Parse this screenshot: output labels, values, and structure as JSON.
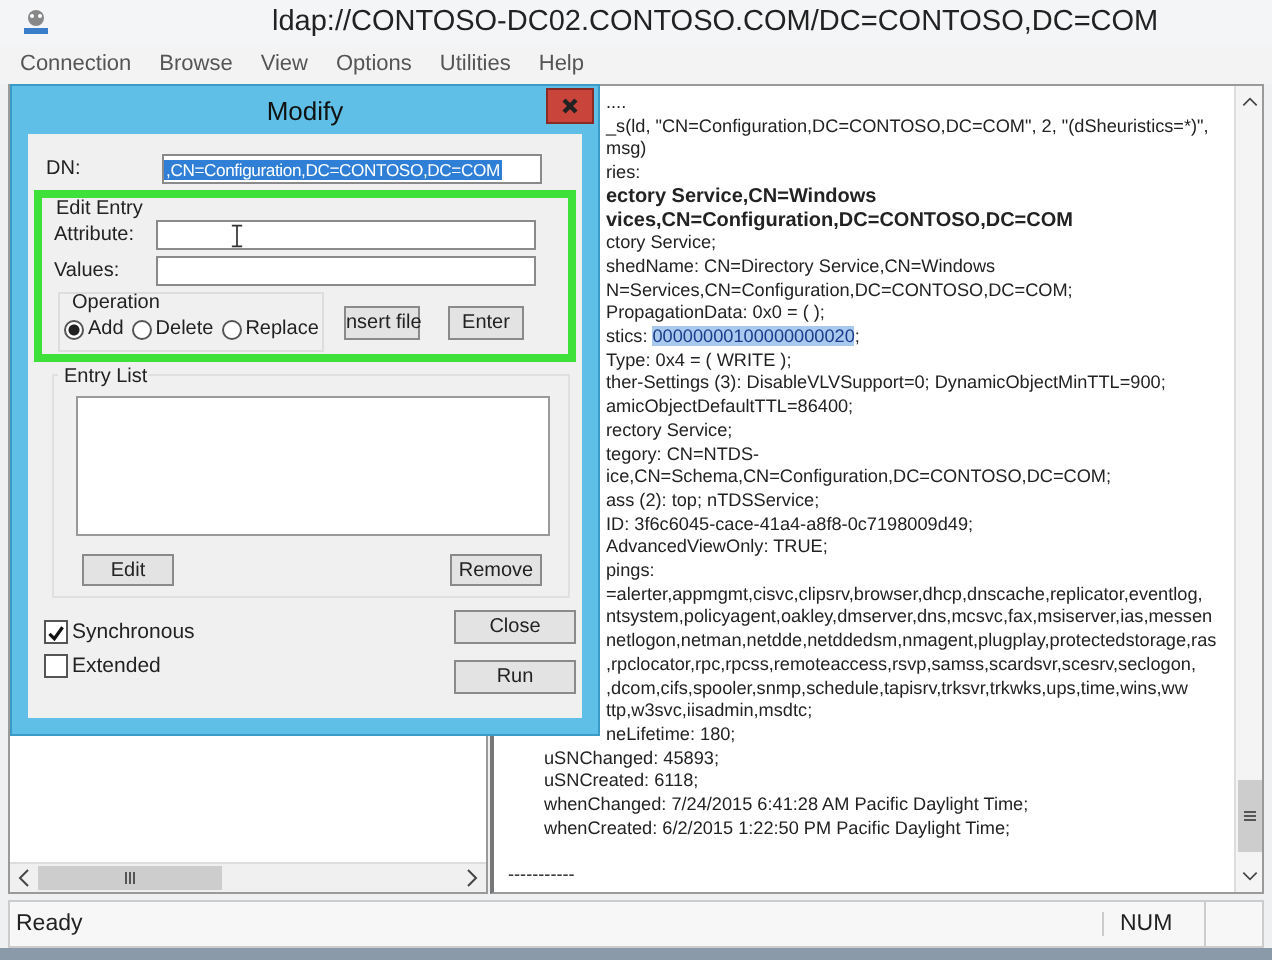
{
  "window": {
    "title": "ldap://CONTOSO-DC02.CONTOSO.COM/DC=CONTOSO,DC=COM"
  },
  "menu": [
    "Connection",
    "Browse",
    "View",
    "Options",
    "Utilities",
    "Help"
  ],
  "output": {
    "lines": [
      {
        "kind": "cut",
        "bold": false,
        "text": "...."
      },
      {
        "kind": "cut",
        "bold": false,
        "text": "_s(ld, \"CN=Configuration,DC=CONTOSO,DC=COM\", 2, \"(dSheuristics=*)\","
      },
      {
        "kind": "cut",
        "bold": false,
        "text": "msg)"
      },
      {
        "kind": "cut",
        "bold": false,
        "text": "ries:"
      },
      {
        "kind": "cut",
        "bold": true,
        "text": "ectory Service,CN=Windows"
      },
      {
        "kind": "cut",
        "bold": true,
        "text": "vices,CN=Configuration,DC=CONTOSO,DC=COM"
      },
      {
        "kind": "cut",
        "bold": false,
        "text": "ctory Service;"
      },
      {
        "kind": "cut",
        "bold": false,
        "text": "shedName: CN=Directory Service,CN=Windows"
      },
      {
        "kind": "cut",
        "bold": false,
        "text": "N=Services,CN=Configuration,DC=CONTOSO,DC=COM;"
      },
      {
        "kind": "cut",
        "bold": false,
        "text": "PropagationData: 0x0 = (  );"
      },
      {
        "kind": "cut",
        "bold": false,
        "text": "stics: ",
        "selection": "00000000100000000020",
        "after": ";"
      },
      {
        "kind": "cut",
        "bold": false,
        "text": "Type: 0x4 = ( WRITE );"
      },
      {
        "kind": "cut",
        "bold": false,
        "text": "ther-Settings (3): DisableVLVSupport=0; DynamicObjectMinTTL=900;"
      },
      {
        "kind": "cut",
        "bold": false,
        "text": "amicObjectDefaultTTL=86400;"
      },
      {
        "kind": "cut",
        "bold": false,
        "text": "rectory Service;"
      },
      {
        "kind": "cut",
        "bold": false,
        "text": "tegory: CN=NTDS-"
      },
      {
        "kind": "cut",
        "bold": false,
        "text": "ice,CN=Schema,CN=Configuration,DC=CONTOSO,DC=COM;"
      },
      {
        "kind": "cut",
        "bold": false,
        "text": "ass (2): top; nTDSService;"
      },
      {
        "kind": "cut",
        "bold": false,
        "text": "ID: 3f6c6045-cace-41a4-a8f8-0c7198009d49;"
      },
      {
        "kind": "cut",
        "bold": false,
        "text": "AdvancedViewOnly: TRUE;"
      },
      {
        "kind": "cut",
        "bold": false,
        "text": "pings:"
      },
      {
        "kind": "cut",
        "bold": false,
        "text": "=alerter,appmgmt,cisvc,clipsrv,browser,dhcp,dnscache,replicator,eventlog,"
      },
      {
        "kind": "cut",
        "bold": false,
        "text": "ntsystem,policyagent,oakley,dmserver,dns,mcsvc,fax,msiserver,ias,messen"
      },
      {
        "kind": "cut",
        "bold": false,
        "text": "netlogon,netman,netdde,netddedsm,nmagent,plugplay,protectedstorage,ras"
      },
      {
        "kind": "cut",
        "bold": false,
        "text": ",rpclocator,rpc,rpcss,remoteaccess,rsvp,samss,scardsvr,scesrv,seclogon,"
      },
      {
        "kind": "cut",
        "bold": false,
        "text": ",dcom,cifs,spooler,snmp,schedule,tapisrv,trksvr,trkwks,ups,time,wins,ww"
      },
      {
        "kind": "cut",
        "bold": false,
        "text": "ttp,w3svc,iisadmin,msdtc;"
      },
      {
        "kind": "cut",
        "bold": false,
        "text": "neLifetime: 180;"
      },
      {
        "kind": "indented",
        "bold": false,
        "text": "uSNChanged: 45893;"
      },
      {
        "kind": "indented",
        "bold": false,
        "text": "uSNCreated: 6118;"
      },
      {
        "kind": "indented",
        "bold": false,
        "text": "whenChanged: 7/24/2015 6:41:28 AM Pacific Daylight Time;"
      },
      {
        "kind": "indented",
        "bold": false,
        "text": "whenCreated: 6/2/2015 1:22:50 PM Pacific Daylight Time;"
      },
      {
        "kind": "gap"
      },
      {
        "kind": "plain",
        "bold": false,
        "text": "-----------"
      }
    ]
  },
  "dialog": {
    "title": "Modify",
    "dn": {
      "label": "DN:",
      "value": ",CN=Configuration,DC=CONTOSO,DC=COM",
      "selected": true
    },
    "edit_entry": {
      "label": "Edit Entry",
      "attribute_label": "Attribute:",
      "values_label": "Values:",
      "operation": {
        "label": "Operation",
        "options": [
          {
            "label": "Add",
            "selected": true
          },
          {
            "label": "Delete",
            "selected": false
          },
          {
            "label": "Replace",
            "selected": false
          }
        ]
      },
      "buttons": [
        "nsert file",
        "Enter"
      ]
    },
    "entry_list": {
      "label": "Entry List",
      "buttons": [
        "Edit",
        "Remove"
      ]
    },
    "options": [
      {
        "label": "Synchronous",
        "checked": true
      },
      {
        "label": "Extended",
        "checked": false
      }
    ],
    "buttons": [
      "Close",
      "Run"
    ]
  },
  "status_bar": {
    "message": "Ready",
    "num": "NUM"
  }
}
